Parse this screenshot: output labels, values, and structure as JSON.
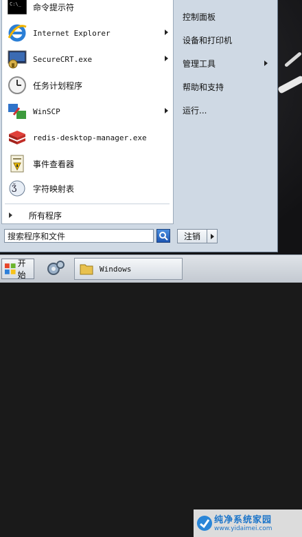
{
  "programs": [
    {
      "label": "命令提示符",
      "icon": "cmd-icon",
      "submenu": false,
      "mono": false
    },
    {
      "label": "Internet Explorer",
      "icon": "internet-explorer-icon",
      "submenu": true,
      "mono": true
    },
    {
      "label": "SecureCRT.exe",
      "icon": "securecrt-icon",
      "submenu": true,
      "mono": true
    },
    {
      "label": "任务计划程序",
      "icon": "clock-icon",
      "submenu": false,
      "mono": false
    },
    {
      "label": "WinSCP",
      "icon": "winscp-icon",
      "submenu": true,
      "mono": true
    },
    {
      "label": "redis-desktop-manager.exe",
      "icon": "redis-icon",
      "submenu": false,
      "mono": true
    },
    {
      "label": "事件查看器",
      "icon": "event-viewer-icon",
      "submenu": false,
      "mono": false
    },
    {
      "label": "字符映射表",
      "icon": "charmap-icon",
      "submenu": false,
      "mono": false
    }
  ],
  "all_programs": "所有程序",
  "search": {
    "text": "搜索程序和文件"
  },
  "right_pane": [
    {
      "label": "控制面板",
      "submenu": false
    },
    {
      "label": "设备和打印机",
      "submenu": false
    },
    {
      "label": "管理工具",
      "submenu": true
    },
    {
      "label": "帮助和支持",
      "submenu": false
    },
    {
      "label": "运行...",
      "submenu": false
    }
  ],
  "shutdown": {
    "label": "注销"
  },
  "taskbar": {
    "start_label": "开始",
    "windows_label": "Windows"
  },
  "watermark": {
    "title": "纯净系统家园",
    "url": "www.yidaimei.com"
  }
}
